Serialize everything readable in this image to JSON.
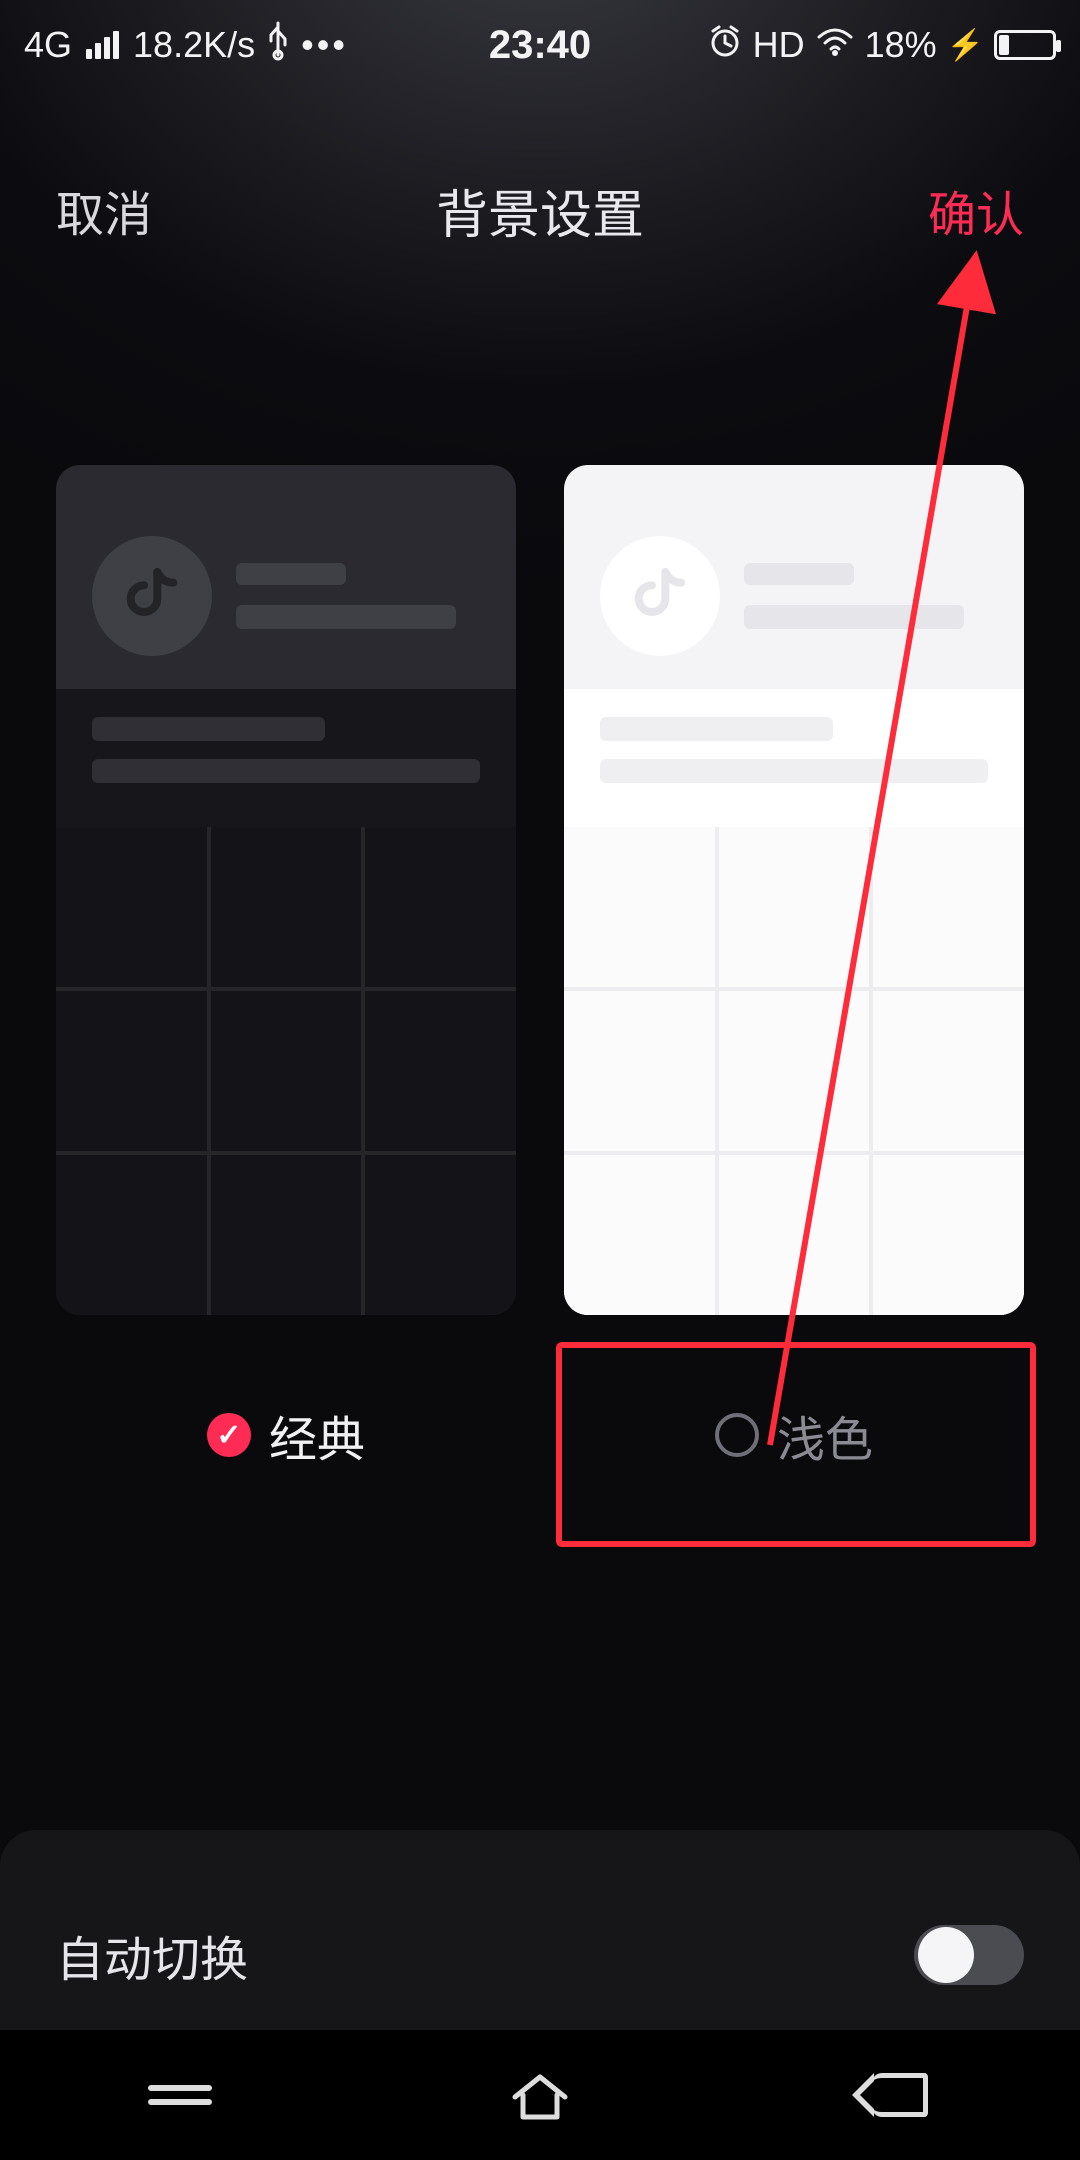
{
  "status": {
    "network": "4G",
    "speed": "18.2K/s",
    "time": "23:40",
    "hd": "HD",
    "battery_pct": "18%"
  },
  "nav": {
    "cancel": "取消",
    "title": "背景设置",
    "confirm": "确认"
  },
  "themes": {
    "classic_label": "经典",
    "light_label": "浅色"
  },
  "auto_switch": {
    "label": "自动切换",
    "enabled": false
  },
  "colors": {
    "accent": "#fe2c55",
    "annotation": "#fe2c3a"
  }
}
